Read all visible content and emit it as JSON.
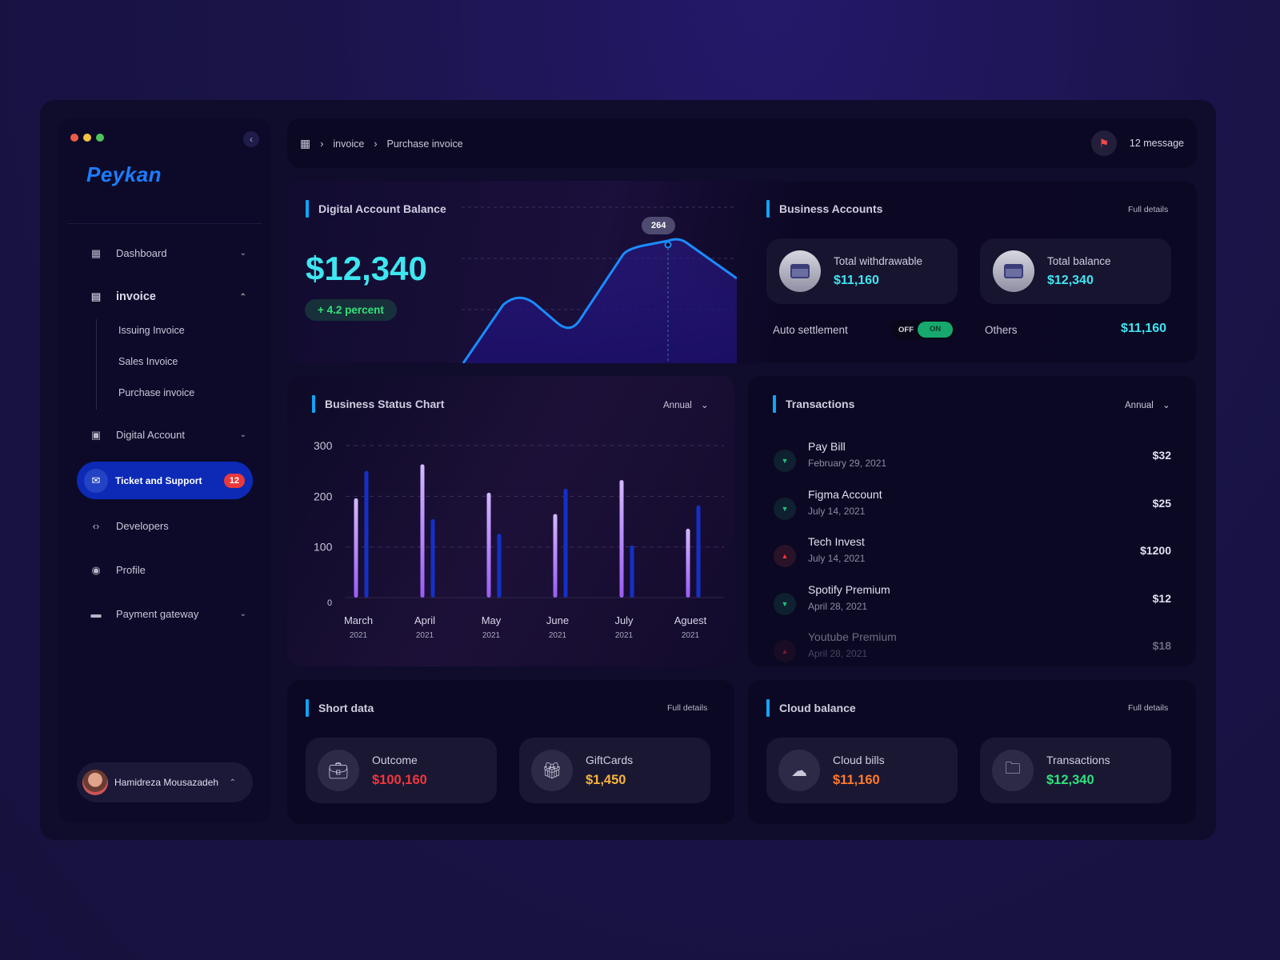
{
  "window": {
    "dot_colors": [
      "#ed5b48",
      "#f5c242",
      "#4cc65a"
    ]
  },
  "sidebar": {
    "logo": "Peykan",
    "items": [
      {
        "label": "Dashboard",
        "icon": "grid-icon"
      },
      {
        "label": "invoice",
        "icon": "document-icon",
        "expanded": true,
        "children": [
          "Issuing Invoice",
          "Sales Invoice",
          "Purchase invoice"
        ]
      },
      {
        "label": "Digital Account",
        "icon": "wallet-icon"
      },
      {
        "label": "Ticket and Support",
        "icon": "mail-icon",
        "active": true,
        "badge": "12"
      },
      {
        "label": "Developers",
        "icon": "code-icon"
      },
      {
        "label": "Profile",
        "icon": "user-circle-icon"
      },
      {
        "label": "Payment gateway",
        "icon": "credit-card-icon"
      }
    ],
    "user": {
      "name": "Hamidreza Mousazadeh"
    }
  },
  "header": {
    "breadcrumb": [
      "invoice",
      "Purchase invoice"
    ],
    "messages": "12 message"
  },
  "balance": {
    "title": "Digital Account Balance",
    "amount": "$12,340",
    "change": "+ 4.2 percent",
    "tooltip": "264"
  },
  "business": {
    "title": "Business Accounts",
    "full_details": "Full details",
    "cards": [
      {
        "label": "Total withdrawable",
        "value": "$11,160"
      },
      {
        "label": "Total balance",
        "value": "$12,340"
      }
    ],
    "auto_settlement": "Auto settlement",
    "toggle_off": "OFF",
    "toggle_on": "ON",
    "toggle_state": "on",
    "others_label": "Others",
    "others_value": "$11,160"
  },
  "status_chart": {
    "title": "Business Status Chart",
    "period": "Annual"
  },
  "chart_data": {
    "type": "bar",
    "title": "Business Status Chart",
    "categories": [
      "March",
      "April",
      "May",
      "June",
      "July",
      "Aguest"
    ],
    "category_sublabels": [
      "2021",
      "2021",
      "2021",
      "2021",
      "2021",
      "2021"
    ],
    "series": [
      {
        "values": [
          196,
          263,
          207,
          165,
          232,
          136
        ],
        "color": "#b58cff"
      },
      {
        "values": [
          250,
          155,
          126,
          215,
          103,
          182
        ],
        "color": "#1530c8"
      }
    ],
    "yticks": [
      "0",
      "100",
      "200",
      "300"
    ],
    "ylim": [
      0,
      300
    ],
    "grid": true
  },
  "transactions": {
    "title": "Transactions",
    "period": "Annual",
    "items": [
      {
        "name": "Pay Bill",
        "date": "February 29, 2021",
        "amount": "$32",
        "direction": "down"
      },
      {
        "name": "Figma Account",
        "date": "July 14, 2021",
        "amount": "$25",
        "direction": "down"
      },
      {
        "name": "Tech Invest",
        "date": "July 14, 2021",
        "amount": "$1200",
        "direction": "up"
      },
      {
        "name": "Spotify Premium",
        "date": "April 28, 2021",
        "amount": "$12",
        "direction": "down"
      },
      {
        "name": "Youtube Premium",
        "date": "April 28, 2021",
        "amount": "$18",
        "direction": "up"
      }
    ]
  },
  "short_data": {
    "title": "Short data",
    "full_details": "Full details",
    "cards": [
      {
        "label": "Outcome",
        "value": "$100,160",
        "color": "#f0383c",
        "icon": "briefcase-icon"
      },
      {
        "label": "GiftCards",
        "value": "$1,450",
        "color": "#f5b43a",
        "icon": "gift-card-icon"
      }
    ]
  },
  "cloud": {
    "title": "Cloud balance",
    "full_details": "Full details",
    "cards": [
      {
        "label": "Cloud bills",
        "value": "$11,160",
        "color": "#ff7a2a",
        "icon": "cloud-icon"
      },
      {
        "label": "Transactions",
        "value": "$12,340",
        "color": "#2ee37a",
        "icon": "folder-icon"
      }
    ]
  },
  "colors": {
    "accent": "#0ea5f5",
    "cyan": "#3ee6f0",
    "active_nav": "#0c2ab5",
    "line": "#1a8cff"
  }
}
